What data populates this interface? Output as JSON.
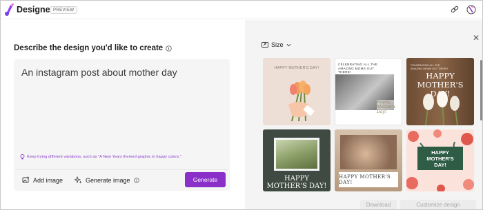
{
  "app": {
    "name": "Designer",
    "badge": "PREVIEW"
  },
  "left": {
    "heading": "Describe the design you'd like to create",
    "prompt_value": "An instagram post about mother day",
    "tip": "Keep trying different variations, such as \"A New Years themed graphic in happy colors.\"",
    "add_image_label": "Add image",
    "generate_image_label": "Generate image",
    "generate_button": "Generate"
  },
  "right": {
    "size_label": "Size",
    "download_label": "Download",
    "customize_label": "Customize design",
    "cards": [
      {
        "text": "HAPPY MOTHER'S DAY!"
      },
      {
        "text": "CELEBRATING ALL THE AMAZING MOMS OUT THERE!",
        "script": "Happy Mother's Day!"
      },
      {
        "text": "HAPPY MOTHER'S DAY!",
        "small": "CELEBRATING ALL THE AMAZING MOMS OUT THERE!"
      },
      {
        "text": "HAPPY MOTHER'S DAY!"
      },
      {
        "text": "HAPPY MOTHER'S DAY!"
      },
      {
        "text": "HAPPY MOTHER'S DAY!"
      }
    ]
  },
  "colors": {
    "accent": "#8b2fc9",
    "tip": "#8a3ec9"
  }
}
